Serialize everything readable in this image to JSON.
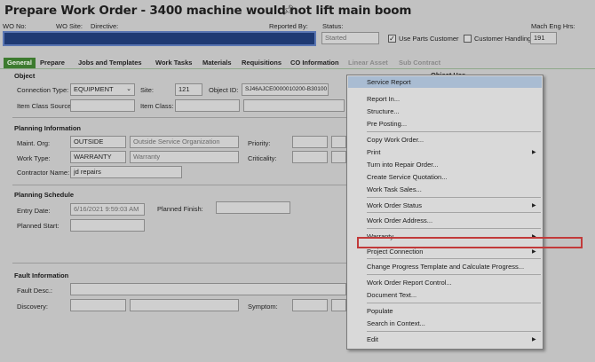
{
  "header": {
    "title": "Prepare Work Order - 3400 machine would not lift main boom",
    "labels": {
      "wo_no": "WO No:",
      "wo_site": "WO Site:",
      "directive": "Directive:",
      "reported_by": "Reported By:",
      "status": "Status:",
      "mach_eng_hrs": "Mach Eng Hrs:"
    },
    "status_value": "Started",
    "use_parts_customer": "Use Parts Customer",
    "customer_handling": "Customer Handling",
    "mach_eng_hrs_value": "191"
  },
  "tabs": [
    {
      "label": "General",
      "active": true
    },
    {
      "label": "Prepare"
    },
    {
      "label": "Jobs and Templates"
    },
    {
      "label": "Work Tasks"
    },
    {
      "label": "Materials"
    },
    {
      "label": "Requisitions"
    },
    {
      "label": "CO Information"
    },
    {
      "label": "Linear Asset",
      "disabled": true
    },
    {
      "label": "Sub Contract",
      "disabled": true
    }
  ],
  "object": {
    "heading": "Object",
    "connection_type_label": "Connection Type:",
    "connection_type_value": "EQUIPMENT",
    "site_label": "Site:",
    "site_value": "121",
    "object_id_label": "Object ID:",
    "object_id_value": "SJ46AJCE0000010200-B30100",
    "item_class_source_label": "Item Class Source:",
    "item_class_label": "Item Class:",
    "object_has_partial": "Object Has"
  },
  "planning_info": {
    "heading": "Planning Information",
    "maint_org_label": "Maint. Org:",
    "maint_org_value": "OUTSIDE",
    "maint_org_desc": "Outside Service Organization",
    "priority_label": "Priority:",
    "work_type_label": "Work Type:",
    "work_type_value": "WARRANTY",
    "work_type_desc": "Warranty",
    "criticality_label": "Criticality:",
    "contractor_name_label": "Contractor Name:",
    "contractor_name_value": "jd repairs"
  },
  "planning_schedule": {
    "heading": "Planning Schedule",
    "entry_date_label": "Entry Date:",
    "entry_date_value": "6/16/2021 9:59:03 AM",
    "planned_finish_label": "Planned Finish:",
    "planned_start_label": "Planned Start:"
  },
  "fault_info": {
    "heading": "Fault Information",
    "fault_desc_label": "Fault Desc.:",
    "discovery_label": "Discovery:",
    "symptom_label": "Symptom:"
  },
  "context_menu": {
    "items": [
      {
        "label": "Service Report",
        "highlighted": true
      },
      {
        "label": "Report In..."
      },
      {
        "label": "Structure..."
      },
      {
        "label": "Pre Posting..."
      },
      {
        "label": "Copy Work Order..."
      },
      {
        "label": "Print",
        "submenu": true
      },
      {
        "label": "Turn into Repair Order..."
      },
      {
        "label": "Create Service Quotation..."
      },
      {
        "label": "Work Task Sales..."
      },
      {
        "label": "Work Order Status",
        "submenu": true
      },
      {
        "label": "Work Order Address..."
      },
      {
        "label": "Warranty",
        "submenu": true
      },
      {
        "label": "Project Connection",
        "submenu": true
      },
      {
        "label": "Change Progress Template and Calculate Progress..."
      },
      {
        "label": "Work Order Report Control..."
      },
      {
        "label": "Document Text..."
      },
      {
        "label": "Populate"
      },
      {
        "label": "Search in Context..."
      },
      {
        "label": "Edit",
        "submenu": true
      }
    ]
  },
  "colors": {
    "active_tab": "#3d7b2f",
    "menu_highlight": "#a9bcd2",
    "annotation_box": "#c23a3a",
    "wo_field": "#1f3a73"
  }
}
